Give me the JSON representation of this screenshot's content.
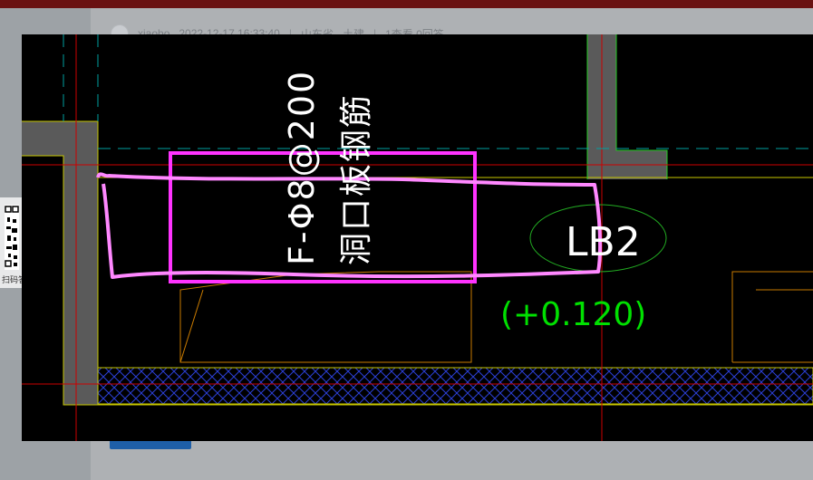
{
  "post": {
    "author": "xiaobo",
    "datetime": "2022-12-17 16:33:40",
    "location": "山东省",
    "category": "土建",
    "stats": "1查看  0回答",
    "separator": "|"
  },
  "qr": {
    "label": "扫码答"
  },
  "cad": {
    "rebar_label": "F-Φ8@200",
    "note_label": "洞口板钢筋",
    "beam_tag": "LB2",
    "elevation": "(+0.120)"
  },
  "colors": {
    "background": "#000000",
    "annotation_magenta": "#ff33ff",
    "wall_outline": "#c8c800",
    "axis_red": "#cc0000",
    "dashed_cyan": "#00a0a0",
    "hatch_blue": "#2b3fd6",
    "elevation_green": "#00e000"
  }
}
